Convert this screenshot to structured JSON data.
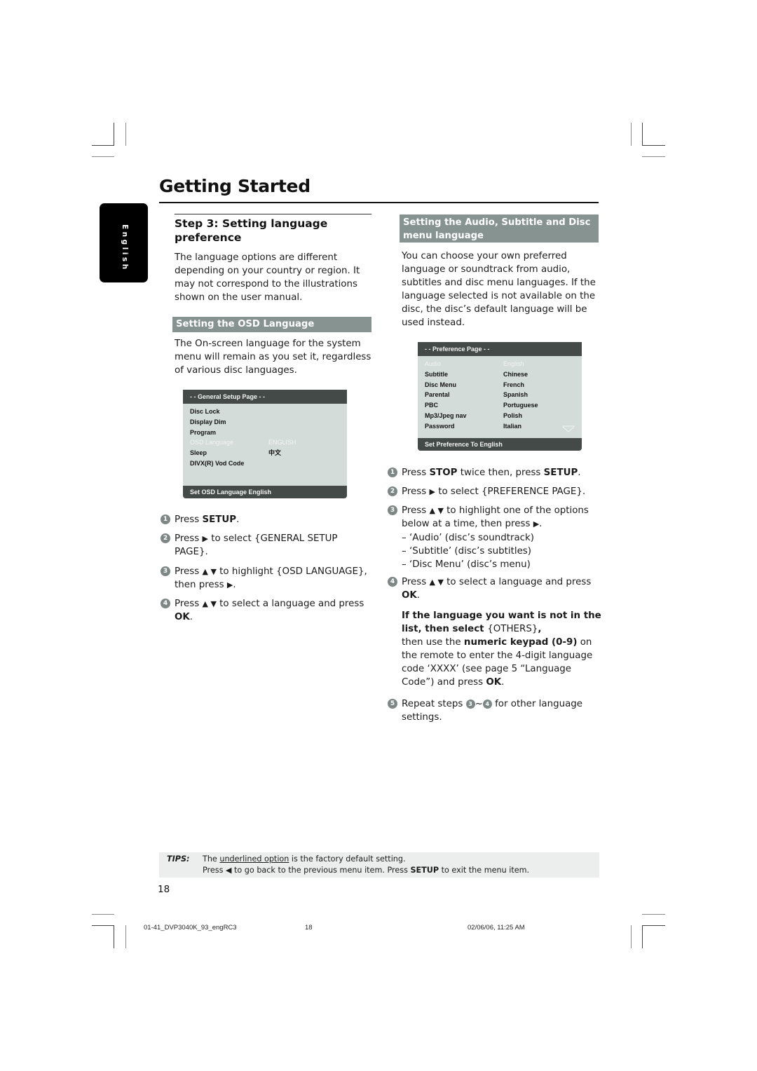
{
  "header": {
    "title": "Getting Started",
    "language_tab": "English"
  },
  "left_column": {
    "step_title": "Step 3:  Setting language preference",
    "intro": "The language options are different depending on your country or region. It may not correspond to the illustrations shown on the user manual.",
    "section_title": "Setting the OSD Language",
    "section_text": "The On-screen language for the system menu will remain as you set it, regardless of various disc languages.",
    "menu": {
      "header": "- -   General Setup Page   - -",
      "items": [
        {
          "label": "Disc Lock",
          "value": "",
          "highlighted": false
        },
        {
          "label": "Display Dim",
          "value": "",
          "highlighted": false
        },
        {
          "label": "Program",
          "value": "",
          "highlighted": false
        },
        {
          "label": "OSD Language",
          "value": "ENGLISH",
          "highlighted": true
        },
        {
          "label": "Sleep",
          "value": "中文",
          "highlighted": false
        },
        {
          "label": "DIVX(R) Vod Code",
          "value": "",
          "highlighted": false
        }
      ],
      "footer": "Set OSD Language English"
    },
    "steps": [
      {
        "num": "1",
        "parts": [
          {
            "t": "Press "
          },
          {
            "t": "SETUP",
            "b": true
          },
          {
            "t": "."
          }
        ]
      },
      {
        "num": "2",
        "parts": [
          {
            "t": "Press "
          },
          {
            "t": "▶",
            "icon": "play-right-icon"
          },
          {
            "t": " to select {GENERAL SETUP PAGE}."
          }
        ]
      },
      {
        "num": "3",
        "parts": [
          {
            "t": "Press "
          },
          {
            "t": "▲ ▼",
            "icon": "up-down-icon"
          },
          {
            "t": " to highlight {OSD LANGUAGE}, then press "
          },
          {
            "t": "▶",
            "icon": "play-right-icon"
          },
          {
            "t": "."
          }
        ]
      },
      {
        "num": "4",
        "parts": [
          {
            "t": "Press "
          },
          {
            "t": "▲ ▼",
            "icon": "up-down-icon"
          },
          {
            "t": "  to select a language and press "
          },
          {
            "t": "OK",
            "b": true
          },
          {
            "t": "."
          }
        ]
      }
    ]
  },
  "right_column": {
    "section_title": "Setting the Audio, Subtitle and Disc menu language",
    "section_text": "You can choose your own preferred language or soundtrack from audio, subtitles and disc menu languages. If the language selected is not available on the disc, the disc’s default language will be used instead.",
    "menu": {
      "header": "- -   Preference Page   - -",
      "items": [
        {
          "label": "Audio",
          "value": "English",
          "highlighted": true
        },
        {
          "label": "Subtitle",
          "value": "Chinese",
          "highlighted": false
        },
        {
          "label": "Disc Menu",
          "value": "French",
          "highlighted": false
        },
        {
          "label": "Parental",
          "value": "Spanish",
          "highlighted": false
        },
        {
          "label": "PBC",
          "value": "Portuguese",
          "highlighted": false
        },
        {
          "label": "Mp3/Jpeg nav",
          "value": "Polish",
          "highlighted": false
        },
        {
          "label": "Password",
          "value": "Italian",
          "highlighted": false
        }
      ],
      "footer": "Set Preference To English"
    },
    "steps": [
      {
        "num": "1",
        "parts": [
          {
            "t": "Press "
          },
          {
            "t": "STOP",
            "b": true
          },
          {
            "t": " twice then, press "
          },
          {
            "t": "SETUP",
            "b": true
          },
          {
            "t": "."
          }
        ]
      },
      {
        "num": "2",
        "parts": [
          {
            "t": "Press "
          },
          {
            "t": "▶",
            "icon": "play-right-icon"
          },
          {
            "t": " to select {PREFERENCE PAGE}."
          }
        ]
      },
      {
        "num": "3",
        "parts": [
          {
            "t": "Press "
          },
          {
            "t": "▲ ▼",
            "icon": "up-down-icon"
          },
          {
            "t": "  to highlight one of the options below at a time, then press "
          },
          {
            "t": "▶",
            "icon": "play-right-icon"
          },
          {
            "t": "."
          }
        ]
      },
      {
        "num": "4",
        "parts": [
          {
            "t": "Press "
          },
          {
            "t": "▲ ▼",
            "icon": "up-down-icon"
          },
          {
            "t": "  to select a language and press "
          },
          {
            "t": "OK",
            "b": true
          },
          {
            "t": "."
          }
        ]
      }
    ],
    "sub_options": [
      "–   ‘Audio’ (disc’s soundtrack)",
      "–   ‘Subtitle’ (disc’s subtitles)",
      "–   ‘Disc Menu’ (disc’s menu)"
    ],
    "note_bold": "If the language you want is not in the list, then select ",
    "note_others": "{OTHERS}",
    "note_comma": ",",
    "note_text_1": "then use the ",
    "note_keypad": "numeric keypad (0-9)",
    "note_text_2": " on the remote to enter the 4-digit language code ‘XXXX’ (see page 5 “Language Code”) and press ",
    "note_ok": "OK",
    "note_end": ".",
    "step5": {
      "num": "5",
      "text_a": "Repeat steps ",
      "ref_a": "3",
      "tilde": "~",
      "ref_b": "4",
      "text_b": " for other language settings."
    }
  },
  "tips": {
    "label": "TIPS:",
    "line1_pre": "The ",
    "line1_underlined": "underlined option",
    "line1_post": " is the factory default setting.",
    "line2_pre": "Press ",
    "line2_icon": "◀",
    "line2_mid": " to go back to the previous menu item. Press ",
    "line2_bold": "SETUP",
    "line2_post": " to exit the menu item."
  },
  "page_number": "18",
  "footer": {
    "file": "01-41_DVP3040K_93_engRC3",
    "page": "18",
    "date": "02/06/06, 11:25 AM"
  }
}
